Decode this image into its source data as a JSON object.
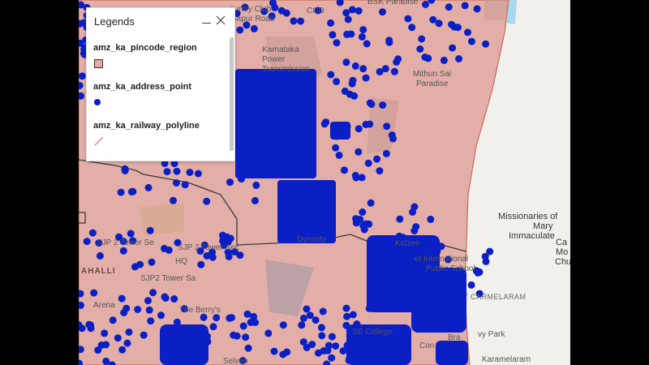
{
  "map": {
    "labels": [
      {
        "id": "country-club",
        "text": "ountry Club"
      },
      {
        "id": "ccd",
        "text": "CCD"
      },
      {
        "id": "bsk-paradise",
        "text": "BSK Paradise"
      },
      {
        "id": "sapur-road",
        "text": "Sapur Road"
      },
      {
        "id": "karnataka",
        "text": "Karnataka"
      },
      {
        "id": "power",
        "text": "Power"
      },
      {
        "id": "transmission",
        "text": "Transmission"
      },
      {
        "id": "mithun-sai",
        "text": "Mithun Sai"
      },
      {
        "id": "paradise",
        "text": "Paradise"
      },
      {
        "id": "missionaries",
        "text": "Missionaries of"
      },
      {
        "id": "mary",
        "text": "Mary"
      },
      {
        "id": "immaculate",
        "text": "Immaculate"
      },
      {
        "id": "ca",
        "text": "Ca"
      },
      {
        "id": "mo",
        "text": "Mo"
      },
      {
        "id": "chu",
        "text": "Chu"
      },
      {
        "id": "sjp2-tower-se",
        "text": "SJP 2 Tower Se"
      },
      {
        "id": "sjp2-tower-sec",
        "text": "SJP 2 Tower Sec"
      },
      {
        "id": "sjp2-tower-sa",
        "text": "SJP2 Tower Sa"
      },
      {
        "id": "hq",
        "text": "HQ"
      },
      {
        "id": "ahalli",
        "text": "AHALLI"
      },
      {
        "id": "dynasty",
        "text": "Dynasty"
      },
      {
        "id": "kidzee",
        "text": "Kidzee"
      },
      {
        "id": "intl-school-1",
        "text": "et International"
      },
      {
        "id": "intl-school-2",
        "text": "Public School"
      },
      {
        "id": "carmelaram",
        "text": "CARMELARAM"
      },
      {
        "id": "the-berrys",
        "text": "The Berry's"
      },
      {
        "id": "arena",
        "text": "Arena"
      },
      {
        "id": "se-college",
        "text": "SE College"
      },
      {
        "id": "vy-park",
        "text": "vy Park"
      },
      {
        "id": "karamelaram",
        "text": "Karamelaram"
      },
      {
        "id": "bra",
        "text": "Bra"
      },
      {
        "id": "con",
        "text": "Con"
      },
      {
        "id": "selvan",
        "text": "Selvan"
      }
    ],
    "colors": {
      "region_fill": "#e2aaa3",
      "region_border": "#c76b5a",
      "point": "#0a1fc4",
      "railway": "#3a3a3a",
      "water": "#a8d8ef",
      "background": "#f1f0ec"
    }
  },
  "legend": {
    "title": "Legends",
    "minimize_icon": "minimize-icon",
    "close_icon": "close-icon",
    "items": [
      {
        "label": "amz_ka_pincode_region",
        "symbol": "square-swatch",
        "color": "#e2aaa3"
      },
      {
        "label": "amz_ka_address_point",
        "symbol": "circle-dot",
        "color": "#0a1fc4"
      },
      {
        "label": "amz_ka_railway_polyline",
        "symbol": "diagonal-line",
        "color": "#c98a6a"
      }
    ]
  }
}
